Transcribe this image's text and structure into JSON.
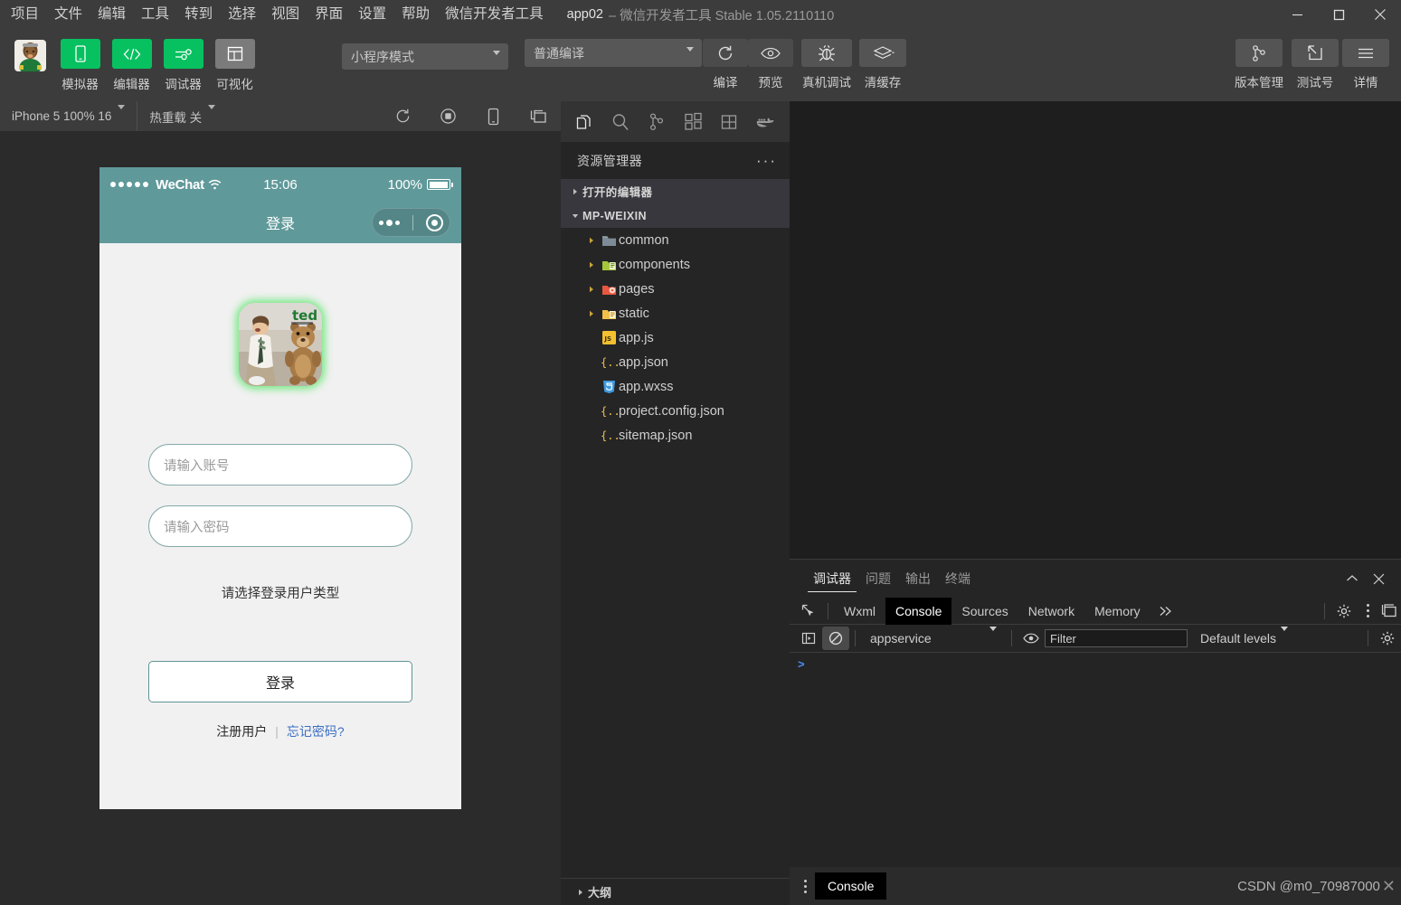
{
  "window": {
    "title_app": "app02",
    "title_rest": "– 微信开发者工具 Stable 1.05.2110110",
    "minimize_label": "minimize",
    "maximize_label": "maximize",
    "close_label": "close"
  },
  "menubar": {
    "items": [
      {
        "label": "项目"
      },
      {
        "label": "文件"
      },
      {
        "label": "编辑"
      },
      {
        "label": "工具"
      },
      {
        "label": "转到"
      },
      {
        "label": "选择"
      },
      {
        "label": "视图"
      },
      {
        "label": "界面"
      },
      {
        "label": "设置"
      },
      {
        "label": "帮助"
      },
      {
        "label": "微信开发者工具"
      }
    ]
  },
  "toolbar": {
    "left_buttons": [
      {
        "label": "模拟器",
        "icon": "phone-outline-icon",
        "style": "green"
      },
      {
        "label": "编辑器",
        "icon": "code-brackets-icon",
        "style": "green"
      },
      {
        "label": "调试器",
        "icon": "sliders-icon",
        "style": "green"
      },
      {
        "label": "可视化",
        "icon": "layout-panel-icon",
        "style": "grey"
      }
    ],
    "mode_select": {
      "value": "小程序模式",
      "icon": "chevron-down-icon"
    },
    "compile_select": {
      "value": "普通编译",
      "icon": "chevron-down-icon"
    },
    "actions": [
      {
        "label": "编译",
        "icon": "refresh-icon"
      },
      {
        "label": "预览",
        "icon": "eye-icon"
      },
      {
        "label": "真机调试",
        "icon": "bug-icon"
      },
      {
        "label": "清缓存",
        "icon": "layers-icon",
        "has_caret": true
      }
    ],
    "right_buttons": [
      {
        "label": "版本管理",
        "icon": "git-branch-icon"
      },
      {
        "label": "测试号",
        "icon": "external-link-icon"
      },
      {
        "label": "详情",
        "icon": "hamburger-icon"
      }
    ]
  },
  "simulator": {
    "device_select": "iPhone 5 100% 16",
    "hotreload_select": "热重载 关",
    "icons": [
      {
        "name": "refresh-icon"
      },
      {
        "name": "record-icon"
      },
      {
        "name": "device-rotate-icon"
      },
      {
        "name": "detach-window-icon"
      }
    ],
    "phone": {
      "statusbar": {
        "carrier": "WeChat",
        "signal_dots": 5,
        "wifi_icon": "wifi-icon",
        "time": "15:06",
        "battery_percent": "100%",
        "battery_icon": "battery-full-icon"
      },
      "navbar": {
        "title": "登录",
        "capsule": {
          "more_icon": "more-dots-icon",
          "target_icon": "target-icon"
        }
      },
      "page": {
        "logo_alt": "ted-app-logo",
        "account_placeholder": "请输入账号",
        "password_placeholder": "请输入密码",
        "usertype_label": "请选择登录用户类型",
        "login_button": "登录",
        "register_link": "注册用户",
        "link_separator": "|",
        "forgot_link": "忘记密码?"
      }
    }
  },
  "explorer": {
    "activity_icons": [
      {
        "name": "files-icon",
        "active": true
      },
      {
        "name": "search-icon",
        "active": false
      },
      {
        "name": "source-control-icon",
        "active": false
      },
      {
        "name": "extensions-icon",
        "active": false
      },
      {
        "name": "cloud-save-icon",
        "active": false
      },
      {
        "name": "docker-icon",
        "active": false
      }
    ],
    "title": "资源管理器",
    "more_actions_icon": "ellipsis-icon",
    "sections": [
      {
        "label": "打开的编辑器",
        "expanded": false,
        "kind": "section"
      },
      {
        "label": "MP-WEIXIN",
        "expanded": true,
        "kind": "section"
      }
    ],
    "files": [
      {
        "label": "common",
        "type": "folder",
        "icon": "folder-grey-icon",
        "expandable": true,
        "indent": 2
      },
      {
        "label": "components",
        "type": "folder",
        "icon": "folder-green-icon",
        "expandable": true,
        "indent": 2
      },
      {
        "label": "pages",
        "type": "folder",
        "icon": "folder-red-icon",
        "expandable": true,
        "indent": 2
      },
      {
        "label": "static",
        "type": "folder",
        "icon": "folder-yellow-icon",
        "expandable": true,
        "indent": 2
      },
      {
        "label": "app.js",
        "type": "file",
        "icon": "js-file-icon",
        "expandable": false,
        "indent": 2
      },
      {
        "label": "app.json",
        "type": "file",
        "icon": "json-file-icon",
        "expandable": false,
        "indent": 2
      },
      {
        "label": "app.wxss",
        "type": "file",
        "icon": "css-file-icon",
        "expandable": false,
        "indent": 2
      },
      {
        "label": "project.config.json",
        "type": "file",
        "icon": "json-file-icon",
        "expandable": false,
        "indent": 2
      },
      {
        "label": "sitemap.json",
        "type": "file",
        "icon": "json-file-icon",
        "expandable": false,
        "indent": 2
      }
    ],
    "outline_label": "大纲"
  },
  "devtools": {
    "panel_tabs": [
      {
        "label": "调试器",
        "active": true
      },
      {
        "label": "问题",
        "active": false
      },
      {
        "label": "输出",
        "active": false
      },
      {
        "label": "终端",
        "active": false
      }
    ],
    "collapse_icon": "chevron-up-icon",
    "close_icon": "close-icon",
    "inspect_icon": "inspect-element-icon",
    "tabs": [
      {
        "label": "Wxml",
        "active": false
      },
      {
        "label": "Console",
        "active": true
      },
      {
        "label": "Sources",
        "active": false
      },
      {
        "label": "Network",
        "active": false
      },
      {
        "label": "Memory",
        "active": false
      }
    ],
    "overflow_icon": "chevrons-right-icon",
    "settings_icon": "gear-icon",
    "kebab_icon": "kebab-menu-icon",
    "dock_icon": "dock-panel-icon",
    "console_toolbar": {
      "sidebar_icon": "console-sidebar-icon",
      "clear_icon": "no-entry-icon",
      "context": "appservice",
      "context_caret": "chevron-down-icon",
      "eye_icon": "eye-icon",
      "filter_placeholder": "Filter",
      "filter_value": "",
      "levels": "Default levels",
      "levels_caret": "chevron-down-icon",
      "settings_icon": "gear-icon"
    },
    "prompt_char": ">",
    "statusbar": {
      "kebab_icon": "kebab-menu-icon",
      "drawer_tab": "Console",
      "watermark": "CSDN @m0_70987000",
      "watermark_close_icon": "close-icon"
    }
  },
  "colors": {
    "accent_green": "#07c160",
    "chrome_bg": "#3c3c3c",
    "editor_bg": "#1e1e1e",
    "sidebar_bg": "#252526",
    "phone_teal": "#60999a",
    "link_blue": "#3b6fc4"
  }
}
